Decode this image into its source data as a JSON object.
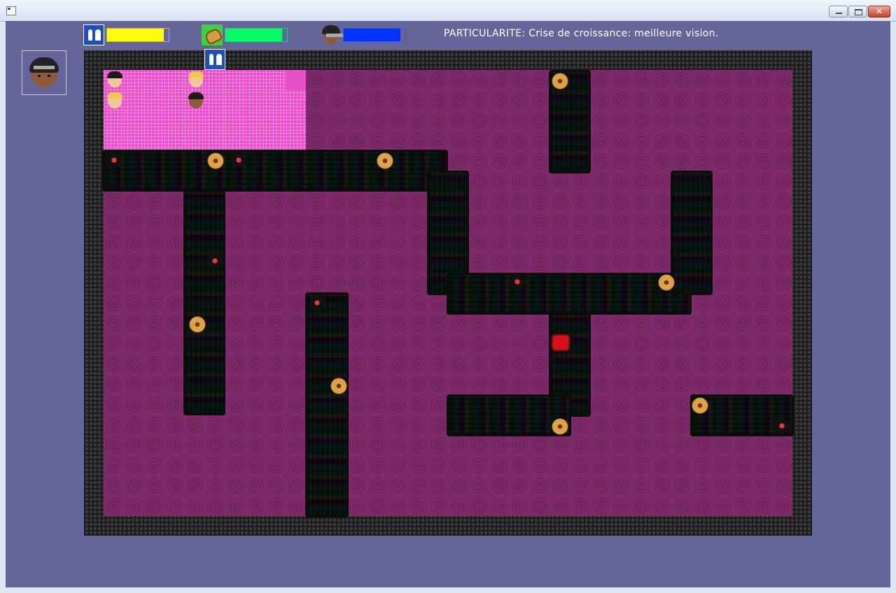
{
  "window": {
    "title": "",
    "close_glyph": "✕"
  },
  "hud": {
    "gauges": [
      {
        "icon": "toilet-icon",
        "level": 0.92,
        "color": "#ffff00"
      },
      {
        "icon": "food-icon",
        "level": 0.92,
        "color": "#00ff66"
      },
      {
        "icon": "face-icon",
        "level": 0.92,
        "color": "#0033ff"
      }
    ],
    "status": "PARTICULARITE: Crise de croissance: meilleure vision."
  },
  "player": {
    "portrait_icon": "player-avatar-icon"
  },
  "board": {
    "floor_color": "#7e2a6a",
    "room_color": "#e64fc7",
    "wall_color": "#3a3a3a",
    "characters": [
      "dark-haired-kid",
      "blond-kid",
      "blond-kid",
      "bearded-man"
    ],
    "items": [
      "burger-icon",
      "record-icon",
      "red-marker",
      "toilet-door-icon"
    ]
  }
}
